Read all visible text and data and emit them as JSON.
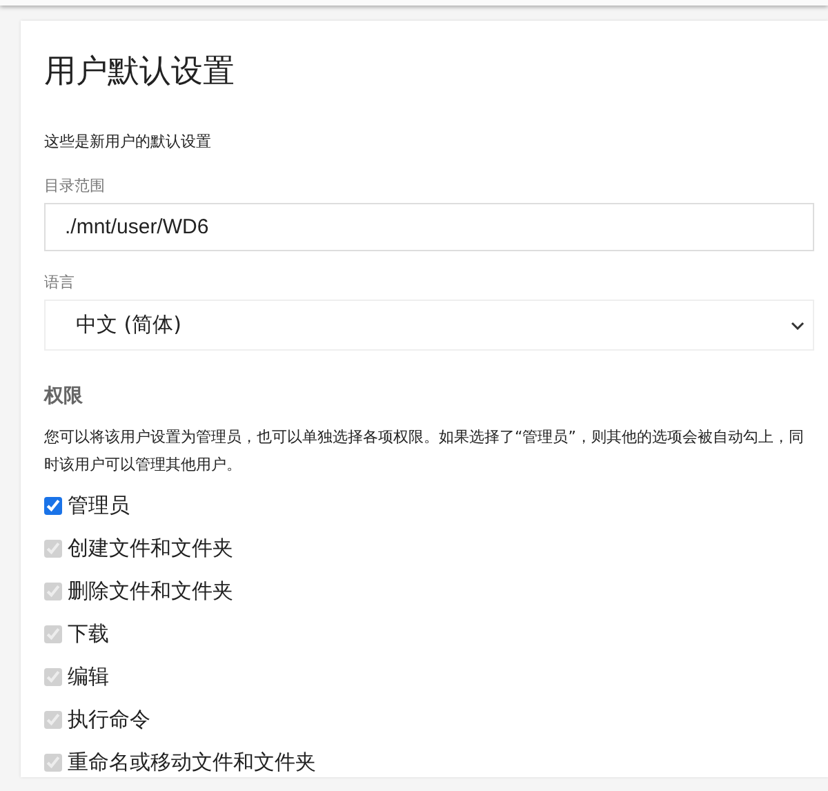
{
  "title": "用户默认设置",
  "description": "这些是新用户的默认设置",
  "scope": {
    "label": "目录范围",
    "value": "./mnt/user/WD6"
  },
  "language": {
    "label": "语言",
    "value": "中文 (简体)"
  },
  "permissions": {
    "heading": "权限",
    "description": "您可以将该用户设置为管理员，也可以单独选择各项权限。如果选择了“管理员”，则其他的选项会被自动勾上，同时该用户可以管理其他用户。",
    "items": [
      {
        "label": "管理员",
        "checked": true,
        "disabled": false
      },
      {
        "label": "创建文件和文件夹",
        "checked": true,
        "disabled": true
      },
      {
        "label": "删除文件和文件夹",
        "checked": true,
        "disabled": true
      },
      {
        "label": "下载",
        "checked": true,
        "disabled": true
      },
      {
        "label": "编辑",
        "checked": true,
        "disabled": true
      },
      {
        "label": "执行命令",
        "checked": true,
        "disabled": true
      },
      {
        "label": "重命名或移动文件和文件夹",
        "checked": true,
        "disabled": true
      }
    ]
  }
}
